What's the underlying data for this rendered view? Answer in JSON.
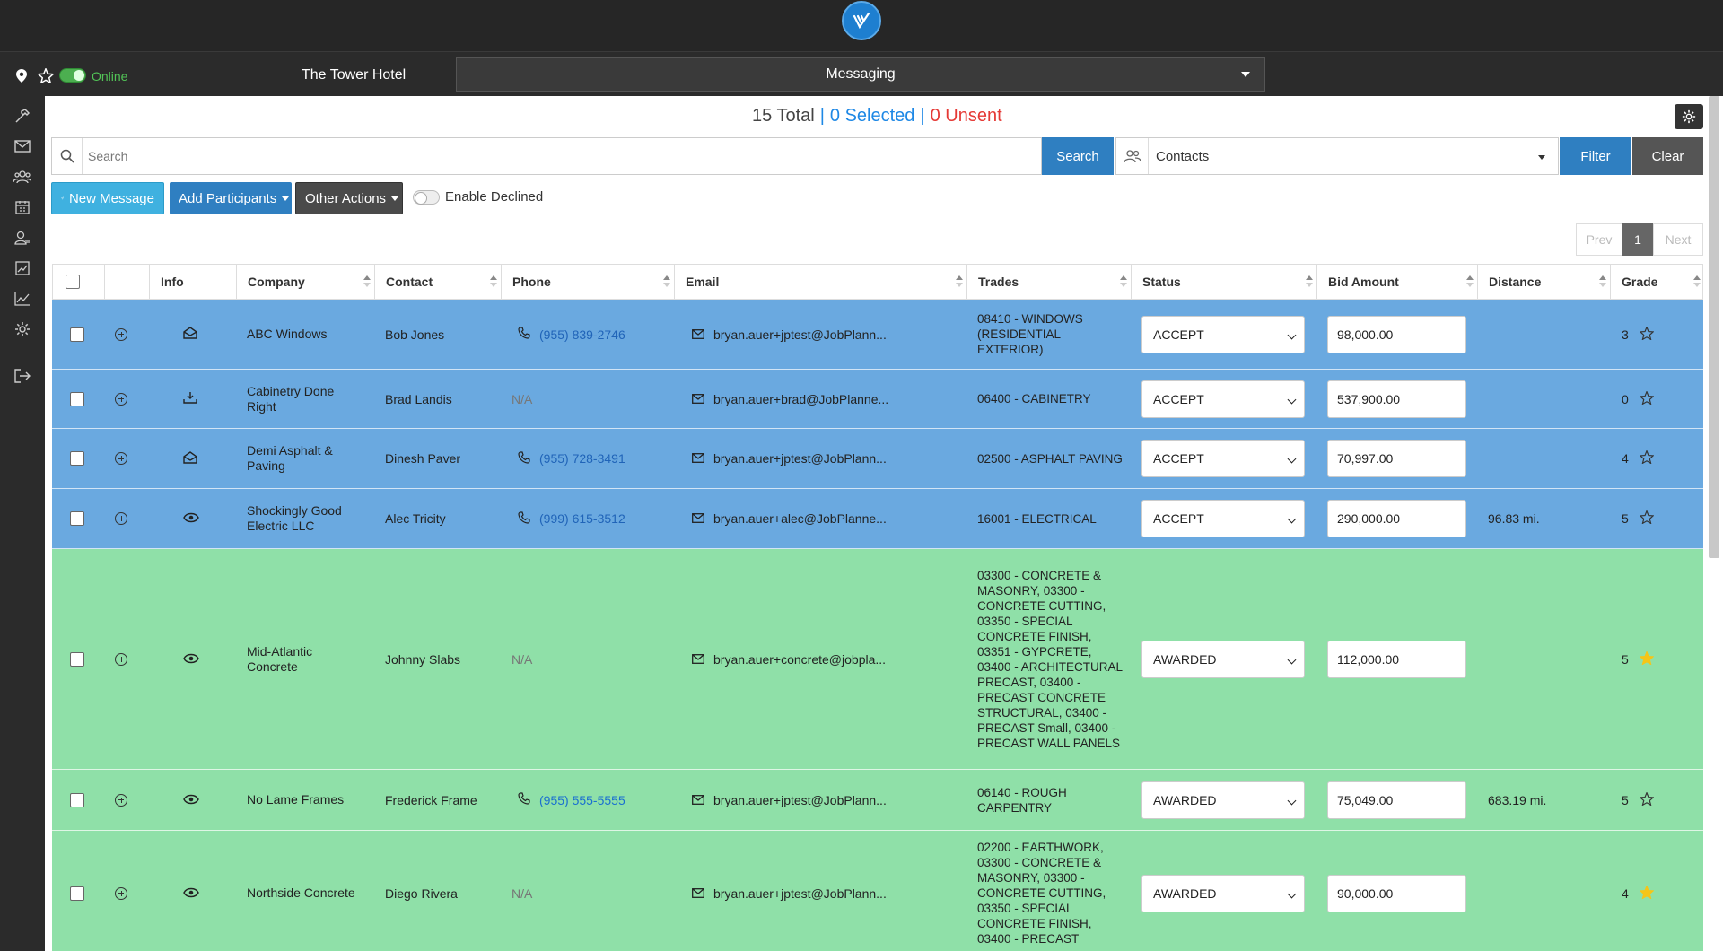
{
  "topbar": {
    "logo": "app-logo"
  },
  "subbar": {
    "online_label": "Online",
    "project_name": "The Tower Hotel",
    "module": "Messaging"
  },
  "summary": {
    "total": "15 Total",
    "separator": "|",
    "selected": "0 Selected",
    "unsent": "0 Unsent"
  },
  "search": {
    "placeholder": "Search",
    "button": "Search",
    "contacts_value": "Contacts",
    "filter": "Filter",
    "clear": "Clear"
  },
  "actions": {
    "new_message": "New Message",
    "add_participants": "Add Participants",
    "other_actions": "Other Actions",
    "enable_declined": "Enable Declined"
  },
  "pager": {
    "prev": "Prev",
    "page": "1",
    "next": "Next"
  },
  "table": {
    "headers": {
      "info": "Info",
      "company": "Company",
      "contact": "Contact",
      "phone": "Phone",
      "email": "Email",
      "trades": "Trades",
      "status": "Status",
      "bid_amount": "Bid Amount",
      "distance": "Distance",
      "grade": "Grade"
    },
    "rows": [
      {
        "info_icon": "envelope-open-icon",
        "company": "ABC Windows",
        "contact": "Bob Jones",
        "phone": "(955) 839-2746",
        "email": "bryan.auer+jptest@JobPlann...",
        "trades": "08410 - WINDOWS (RESIDENTIAL EXTERIOR)",
        "status": "ACCEPT",
        "bid": "98,000.00",
        "distance": "",
        "grade": "3",
        "star_filled": false,
        "row_color": "#6aa9e0"
      },
      {
        "info_icon": "download-tray-icon",
        "company": "Cabinetry Done Right",
        "contact": "Brad Landis",
        "phone": "N/A",
        "email": "bryan.auer+brad@JobPlanne...",
        "trades": "06400 - CABINETRY",
        "status": "ACCEPT",
        "bid": "537,900.00",
        "distance": "",
        "grade": "0",
        "star_filled": false,
        "row_color": "#6aa9e0"
      },
      {
        "info_icon": "envelope-open-icon",
        "company": "Demi Asphalt & Paving",
        "contact": "Dinesh Paver",
        "phone": "(955) 728-3491",
        "email": "bryan.auer+jptest@JobPlann...",
        "trades": "02500 - ASPHALT PAVING",
        "status": "ACCEPT",
        "bid": "70,997.00",
        "distance": "",
        "grade": "4",
        "star_filled": false,
        "row_color": "#6aa9e0"
      },
      {
        "info_icon": "eye-icon",
        "company": "Shockingly Good Electric LLC",
        "contact": "Alec Tricity",
        "phone": "(999) 615-3512",
        "email": "bryan.auer+alec@JobPlanne...",
        "trades": "16001 - ELECTRICAL",
        "status": "ACCEPT",
        "bid": "290,000.00",
        "distance": "96.83 mi.",
        "grade": "5",
        "star_filled": false,
        "row_color": "#6aa9e0"
      },
      {
        "info_icon": "eye-icon",
        "company": "Mid-Atlantic Concrete",
        "contact": "Johnny Slabs",
        "phone": "N/A",
        "email": "bryan.auer+concrete@jobpla...",
        "trades": "03300 - CONCRETE & MASONRY, 03300 - CONCRETE CUTTING, 03350 - SPECIAL CONCRETE FINISH, 03351 - GYPCRETE, 03400 - ARCHITECTURAL PRECAST, 03400 - PRECAST CONCRETE STRUCTURAL, 03400 - PRECAST Small, 03400 - PRECAST WALL PANELS",
        "status": "AWARDED",
        "bid": "112,000.00",
        "distance": "",
        "grade": "5",
        "star_filled": true,
        "row_color": "#8fe0a8"
      },
      {
        "info_icon": "eye-icon",
        "company": "No Lame Frames",
        "contact": "Frederick Frame",
        "phone": "(955) 555-5555",
        "email": "bryan.auer+jptest@JobPlann...",
        "trades": "06140 - ROUGH CARPENTRY",
        "status": "AWARDED",
        "bid": "75,049.00",
        "distance": "683.19 mi.",
        "grade": "5",
        "star_filled": false,
        "row_color": "#8fe0a8"
      },
      {
        "info_icon": "eye-icon",
        "company": "Northside Concrete",
        "contact": "Diego Rivera",
        "phone": "N/A",
        "email": "bryan.auer+jptest@JobPlann...",
        "trades": "02200 - EARTHWORK, 03300 - CONCRETE & MASONRY, 03300 - CONCRETE CUTTING, 03350 - SPECIAL CONCRETE FINISH, 03400 - PRECAST",
        "status": "AWARDED",
        "bid": "90,000.00",
        "distance": "",
        "grade": "4",
        "star_filled": true,
        "row_color": "#8fe0a8"
      }
    ]
  },
  "colors": {
    "accept_row": "#6aa9e0",
    "awarded_row": "#8fe0a8",
    "primary": "#2f7fc1",
    "star": "#f5c518"
  }
}
